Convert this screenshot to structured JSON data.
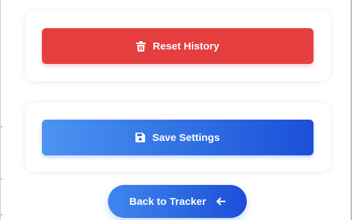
{
  "reset_card": {
    "button_label": "Reset History",
    "icon": "trash-icon",
    "color": "#e53e3e"
  },
  "settings_card": {
    "button_label": "Save Settings",
    "icon": "save-icon",
    "gradient": [
      "#4c93f2",
      "#1c4fd8"
    ]
  },
  "back_button": {
    "label": "Back to Tracker",
    "icon": "arrow-left-icon",
    "gradient": [
      "#3f86ee",
      "#1d4ed8"
    ]
  }
}
